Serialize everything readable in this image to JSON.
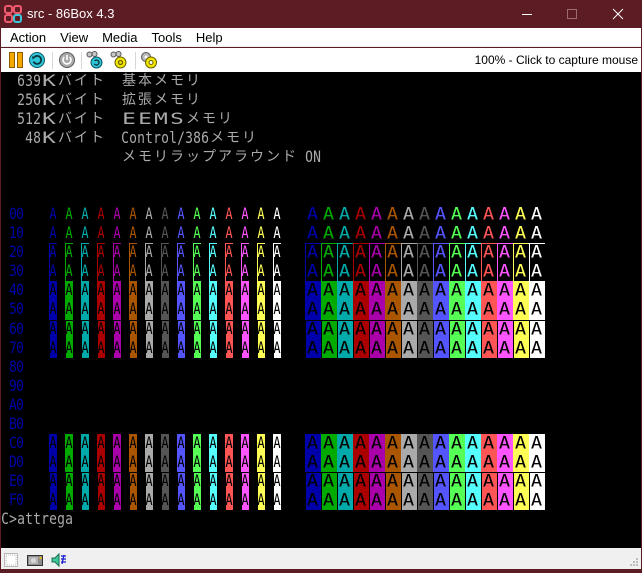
{
  "window": {
    "title": "src - 86Box 4.3",
    "title_bar_color": "#5C1C24",
    "controls": [
      {
        "name": "minimize",
        "icon": "minimize-icon",
        "enabled": true
      },
      {
        "name": "maximize",
        "icon": "maximize-icon",
        "enabled": false
      },
      {
        "name": "close",
        "icon": "close-icon",
        "enabled": true
      }
    ]
  },
  "menu": [
    {
      "label": "Action"
    },
    {
      "label": "View"
    },
    {
      "label": "Media"
    },
    {
      "label": "Tools"
    },
    {
      "label": "Help"
    }
  ],
  "toolbar": {
    "buttons": [
      {
        "name": "pause",
        "icon": "pause-icon"
      },
      {
        "name": "hard-reset",
        "icon": "hard-reset-icon"
      },
      {
        "name": "acpi-shutdown",
        "icon": "power-icon"
      },
      {
        "name": "ctrl-alt-del",
        "icon": "ctrl-alt-del-icon"
      },
      {
        "name": "ctrl-alt-esc",
        "icon": "ctrl-alt-esc-icon"
      },
      {
        "name": "settings",
        "icon": "settings-gear-icon"
      }
    ],
    "status_text": "100% - Click to capture mouse"
  },
  "screen": {
    "text_color": "#AAAAAA",
    "rows": [
      {
        "type": "text",
        "text": "  639Ｋバイト  基本メモリ"
      },
      {
        "type": "text",
        "text": "  256Ｋバイト  拡張メモリ"
      },
      {
        "type": "text",
        "text": "  512Ｋバイト  ＥＥＭＳメモリ"
      },
      {
        "type": "text",
        "text": "   48Ｋバイト  Control/386メモリ"
      },
      {
        "type": "text",
        "text": "               メモリラップアラウンド ON"
      },
      {
        "type": "text",
        "text": ""
      },
      {
        "type": "text",
        "text": ""
      },
      {
        "type": "attr",
        "label": "00",
        "shown": true,
        "reverse": false,
        "overline": false,
        "vline": false
      },
      {
        "type": "attr",
        "label": "10",
        "shown": true,
        "reverse": false,
        "overline": false,
        "vline": false
      },
      {
        "type": "attr",
        "label": "20",
        "shown": true,
        "reverse": false,
        "overline": true,
        "vline": true
      },
      {
        "type": "attr",
        "label": "30",
        "shown": true,
        "reverse": false,
        "overline": false,
        "vline": true
      },
      {
        "type": "attr",
        "label": "40",
        "shown": true,
        "reverse": true,
        "overline": false,
        "vline": false
      },
      {
        "type": "attr",
        "label": "50",
        "shown": true,
        "reverse": true,
        "overline": false,
        "vline": false
      },
      {
        "type": "attr",
        "label": "60",
        "shown": true,
        "reverse": true,
        "overline": true,
        "vline": true
      },
      {
        "type": "attr",
        "label": "70",
        "shown": true,
        "reverse": true,
        "overline": false,
        "vline": true
      },
      {
        "type": "attr",
        "label": "80",
        "shown": false,
        "reverse": false,
        "overline": false,
        "vline": false
      },
      {
        "type": "attr",
        "label": "90",
        "shown": false,
        "reverse": false,
        "overline": false,
        "vline": false
      },
      {
        "type": "attr",
        "label": "A0",
        "shown": false,
        "reverse": false,
        "overline": false,
        "vline": false
      },
      {
        "type": "attr",
        "label": "B0",
        "shown": false,
        "reverse": false,
        "overline": false,
        "vline": false
      },
      {
        "type": "attr",
        "label": "C0",
        "shown": true,
        "reverse": true,
        "overline": false,
        "vline": false
      },
      {
        "type": "attr",
        "label": "D0",
        "shown": true,
        "reverse": true,
        "overline": false,
        "vline": false
      },
      {
        "type": "attr",
        "label": "E0",
        "shown": true,
        "reverse": true,
        "overline": true,
        "vline": true
      },
      {
        "type": "attr",
        "label": "F0",
        "shown": true,
        "reverse": true,
        "overline": false,
        "vline": true
      },
      {
        "type": "text",
        "text": "C>attrega"
      },
      {
        "type": "text",
        "text": ""
      }
    ],
    "attr_table": {
      "label_color": "#0000AA",
      "glyph": "A",
      "blocks": [
        {
          "name": "half-width-block",
          "char_width": "half"
        },
        {
          "name": "full-width-block",
          "char_width": "full"
        }
      ],
      "colors": [
        "#0000AA",
        "#00AA00",
        "#00AAAA",
        "#AA0000",
        "#AA00AA",
        "#AA5500",
        "#AAAAAA",
        "#555555",
        "#5555FF",
        "#55FF55",
        "#55FFFF",
        "#FF5555",
        "#FF55FF",
        "#FFFF55",
        "#FFFFFF"
      ]
    }
  },
  "statusbar": {
    "icons": [
      {
        "name": "floppy-drive",
        "icon": "floppy-icon"
      },
      {
        "name": "hard-disk",
        "icon": "hard-disk-icon"
      },
      {
        "name": "sound",
        "icon": "speaker-icon"
      }
    ]
  }
}
